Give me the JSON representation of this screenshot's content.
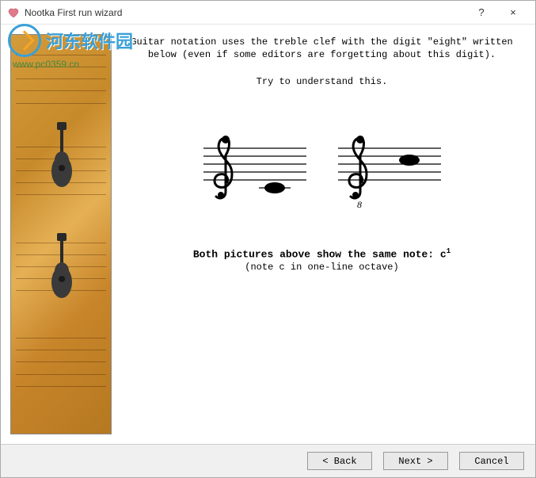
{
  "window": {
    "title": "Nootka   First run wizard",
    "help": "?",
    "close": "×"
  },
  "watermark": {
    "text": "河东软件园",
    "url": "www.pc0359.cn"
  },
  "content": {
    "line1": "Guitar notation uses the treble clef with the digit \"eight\" written below (even if some editors are forgetting about this digit).",
    "line2": "Try to understand this.",
    "bold_prefix": "Both pictures above show the same note: c",
    "bold_sup": "1",
    "sub": "(note c in one-line octave)",
    "octave_digit": "8"
  },
  "buttons": {
    "back": "< Back",
    "next": "Next >",
    "cancel": "Cancel"
  }
}
